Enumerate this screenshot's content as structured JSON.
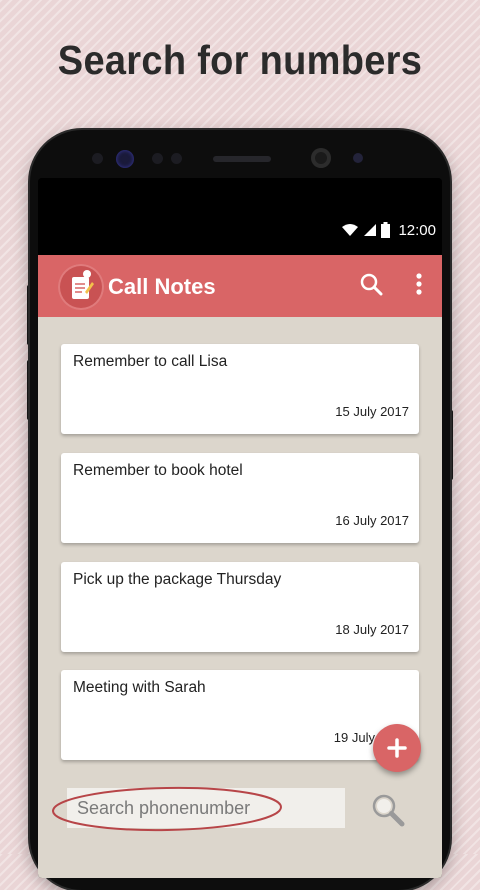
{
  "headline": "Search for numbers",
  "status_bar": {
    "time": "12:00"
  },
  "app_bar": {
    "title": "Call Notes"
  },
  "notes": [
    {
      "text": "Remember to call Lisa",
      "date": "15 July 2017"
    },
    {
      "text": "Remember to book hotel",
      "date": "16 July 2017"
    },
    {
      "text": "Pick up the package Thursday",
      "date": "18 July 2017"
    },
    {
      "text": "Meeting with Sarah",
      "date": "19 July"
    }
  ],
  "search": {
    "placeholder": "Search phonenumber",
    "value": ""
  },
  "colors": {
    "accent": "#d96566",
    "content_bg": "#dcd6cc",
    "page_bg": "#ead5d6"
  },
  "icons": {
    "logo": "notepad-pen-icon",
    "search": "search-icon",
    "more": "more-vertical-icon",
    "add": "plus-icon",
    "search_button": "magnifier-icon"
  }
}
